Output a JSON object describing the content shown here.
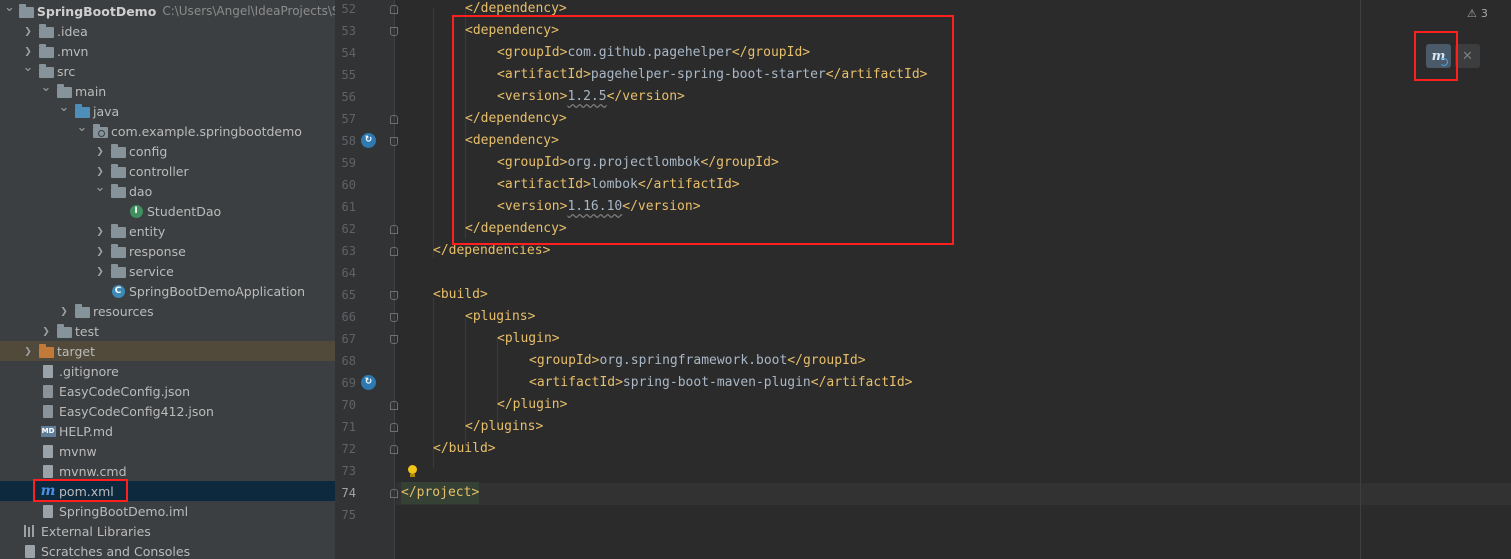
{
  "project": {
    "root_name": "SpringBootDemo",
    "root_path": "C:\\Users\\Angel\\IdeaProjects\\Sp",
    "items": [
      {
        "label": ".idea"
      },
      {
        "label": ".mvn"
      },
      {
        "label": "src"
      },
      {
        "label": "main"
      },
      {
        "label": "java"
      },
      {
        "label": "com.example.springbootdemo"
      },
      {
        "label": "config"
      },
      {
        "label": "controller"
      },
      {
        "label": "dao"
      },
      {
        "label": "StudentDao"
      },
      {
        "label": "entity"
      },
      {
        "label": "response"
      },
      {
        "label": "service"
      },
      {
        "label": "SpringBootDemoApplication"
      },
      {
        "label": "resources"
      },
      {
        "label": "test"
      },
      {
        "label": "target"
      },
      {
        "label": ".gitignore"
      },
      {
        "label": "EasyCodeConfig.json"
      },
      {
        "label": "EasyCodeConfig412.json"
      },
      {
        "label": "HELP.md"
      },
      {
        "label": "mvnw"
      },
      {
        "label": "mvnw.cmd"
      },
      {
        "label": "pom.xml"
      },
      {
        "label": "SpringBootDemo.iml"
      },
      {
        "label": "External Libraries"
      },
      {
        "label": "Scratches and Consoles"
      }
    ],
    "md_badge": "MD"
  },
  "editor": {
    "line_numbers": [
      "52",
      "53",
      "54",
      "55",
      "56",
      "57",
      "58",
      "59",
      "60",
      "61",
      "62",
      "63",
      "64",
      "65",
      "66",
      "67",
      "68",
      "69",
      "70",
      "71",
      "72",
      "73",
      "74",
      "75"
    ],
    "lines": [
      {
        "tag_open": "</dependency>",
        "text": "",
        "tag_close": "",
        "text_wavy": ""
      },
      {
        "tag_open": "<dependency>",
        "text": "",
        "tag_close": "",
        "text_wavy": ""
      },
      {
        "tag_open": "<groupId>",
        "text": "com.github.pagehelper",
        "tag_close": "</groupId>",
        "text_wavy": ""
      },
      {
        "tag_open": "<artifactId>",
        "text": "pagehelper-spring-boot-starter",
        "tag_close": "</artifactId>",
        "text_wavy": ""
      },
      {
        "tag_open": "<version>",
        "text": "",
        "tag_close": "</version>",
        "text_wavy": "1.2.5"
      },
      {
        "tag_open": "</dependency>",
        "text": "",
        "tag_close": "",
        "text_wavy": ""
      },
      {
        "tag_open": "<dependency>",
        "text": "",
        "tag_close": "",
        "text_wavy": ""
      },
      {
        "tag_open": "<groupId>",
        "text": "org.projectlombok",
        "tag_close": "</groupId>",
        "text_wavy": ""
      },
      {
        "tag_open": "<artifactId>",
        "text": "lombok",
        "tag_close": "</artifactId>",
        "text_wavy": ""
      },
      {
        "tag_open": "<version>",
        "text": "",
        "tag_close": "</version>",
        "text_wavy": "1.16.10"
      },
      {
        "tag_open": "</dependency>",
        "text": "",
        "tag_close": "",
        "text_wavy": ""
      },
      {
        "tag_open": "</dependencies>",
        "text": "",
        "tag_close": "",
        "text_wavy": ""
      },
      {
        "tag_open": "",
        "text": "",
        "tag_close": "",
        "text_wavy": ""
      },
      {
        "tag_open": "<build>",
        "text": "",
        "tag_close": "",
        "text_wavy": ""
      },
      {
        "tag_open": "<plugins>",
        "text": "",
        "tag_close": "",
        "text_wavy": ""
      },
      {
        "tag_open": "<plugin>",
        "text": "",
        "tag_close": "",
        "text_wavy": ""
      },
      {
        "tag_open": "<groupId>",
        "text": "org.springframework.boot",
        "tag_close": "</groupId>",
        "text_wavy": ""
      },
      {
        "tag_open": "<artifactId>",
        "text": "spring-boot-maven-plugin",
        "tag_close": "</artifactId>",
        "text_wavy": ""
      },
      {
        "tag_open": "</plugin>",
        "text": "",
        "tag_close": "",
        "text_wavy": ""
      },
      {
        "tag_open": "</plugins>",
        "text": "",
        "tag_close": "",
        "text_wavy": ""
      },
      {
        "tag_open": "</build>",
        "text": "",
        "tag_close": "",
        "text_wavy": ""
      },
      {
        "tag_open": "",
        "text": "",
        "tag_close": "",
        "text_wavy": ""
      },
      {
        "tag_open": "</project>",
        "text": "",
        "tag_close": "",
        "text_wavy": ""
      },
      {
        "tag_open": "",
        "text": "",
        "tag_close": "",
        "text_wavy": ""
      }
    ],
    "warnings_count": "3",
    "maven_reload_icon": "m",
    "close_icon": "✕"
  },
  "colors": {
    "tag": "#e8bf6a",
    "text": "#a9b7c6",
    "highlight_box": "#ff1f1f"
  }
}
